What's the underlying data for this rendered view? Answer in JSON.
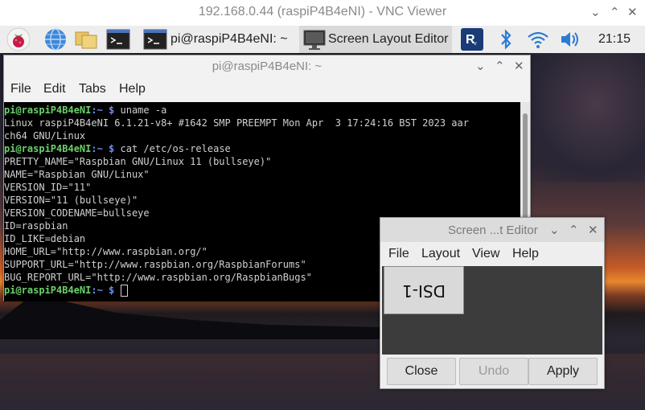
{
  "vnc": {
    "title": "192.168.0.44 (raspiP4B4eNI) - VNC Viewer"
  },
  "taskbar": {
    "terminal_task_label": "pi@raspiP4B4eNI: ~",
    "layout_task_label": "Screen Layout Editor",
    "clock": "21:15",
    "icons": [
      "raspberry-menu-icon",
      "browser-globe-icon",
      "file-manager-icon",
      "terminal-icon",
      "vnc-icon",
      "bluetooth-icon",
      "wifi-icon",
      "volume-icon"
    ]
  },
  "terminal": {
    "title": "pi@raspiP4B4eNI: ~",
    "menu": [
      "File",
      "Edit",
      "Tabs",
      "Help"
    ],
    "prompt_user": "pi@raspiP4B4eNI",
    "prompt_path": ":~ $",
    "lines": [
      {
        "type": "prompt",
        "cmd": " uname -a"
      },
      {
        "type": "out",
        "text": "Linux raspiP4B4eNI 6.1.21-v8+ #1642 SMP PREEMPT Mon Apr  3 17:24:16 BST 2023 aar"
      },
      {
        "type": "out",
        "text": "ch64 GNU/Linux"
      },
      {
        "type": "prompt",
        "cmd": " cat /etc/os-release"
      },
      {
        "type": "out",
        "text": "PRETTY_NAME=\"Raspbian GNU/Linux 11 (bullseye)\""
      },
      {
        "type": "out",
        "text": "NAME=\"Raspbian GNU/Linux\""
      },
      {
        "type": "out",
        "text": "VERSION_ID=\"11\""
      },
      {
        "type": "out",
        "text": "VERSION=\"11 (bullseye)\""
      },
      {
        "type": "out",
        "text": "VERSION_CODENAME=bullseye"
      },
      {
        "type": "out",
        "text": "ID=raspbian"
      },
      {
        "type": "out",
        "text": "ID_LIKE=debian"
      },
      {
        "type": "out",
        "text": "HOME_URL=\"http://www.raspbian.org/\""
      },
      {
        "type": "out",
        "text": "SUPPORT_URL=\"http://www.raspbian.org/RaspbianForums\""
      },
      {
        "type": "out",
        "text": "BUG_REPORT_URL=\"http://www.raspbian.org/RaspbianBugs\""
      },
      {
        "type": "prompt",
        "cmd": " "
      }
    ]
  },
  "layout_editor": {
    "title": "Screen ...t Editor",
    "menu": [
      "File",
      "Layout",
      "View",
      "Help"
    ],
    "display_label": "DSI-1",
    "buttons": {
      "close": "Close",
      "undo": "Undo",
      "apply": "Apply"
    }
  }
}
